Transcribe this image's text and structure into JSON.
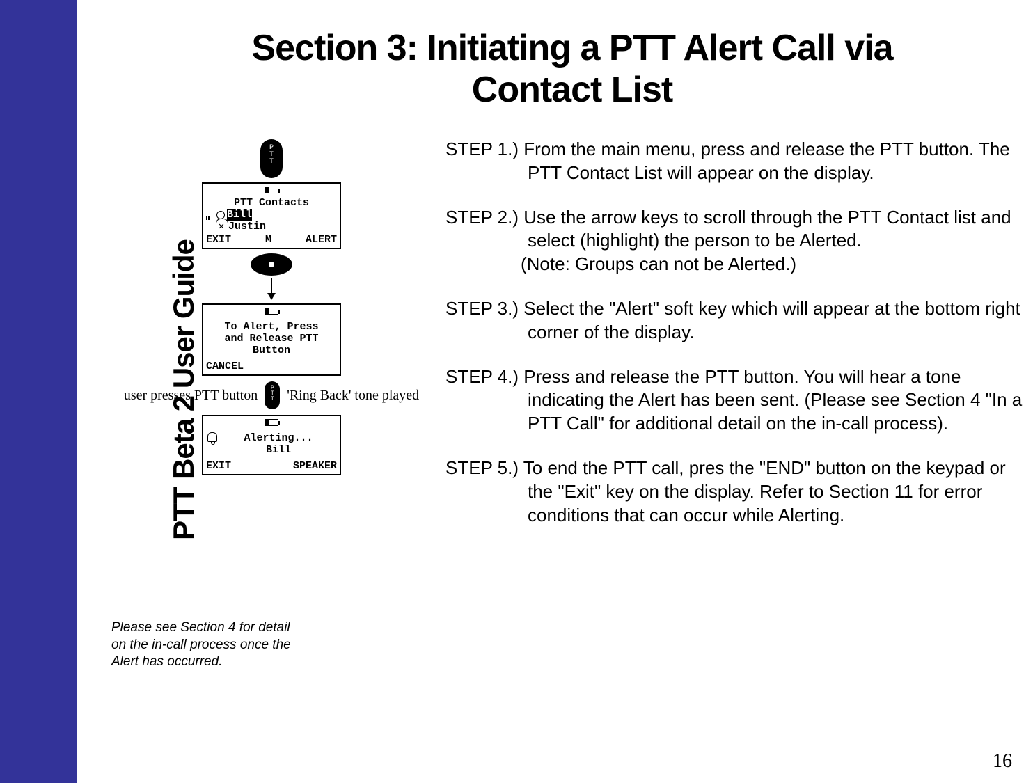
{
  "sidebar_label": "PTT Beta 2 User Guide",
  "title_line1": "Section 3: Initiating a PTT Alert Call via",
  "title_line2": "Contact List",
  "page_number": "16",
  "diagram": {
    "ptt_button_label": "P\nT\nT",
    "screen1": {
      "title": "PTT Contacts",
      "contact_selected": "Bill",
      "contact_other": "Justin",
      "soft_left": "EXIT",
      "soft_mid": "M",
      "soft_right": "ALERT"
    },
    "screen2": {
      "line1": "To Alert, Press",
      "line2": "and Release PTT",
      "line3": "Button",
      "soft_left": "CANCEL"
    },
    "mid_left": "user presses PTT button",
    "mid_right": "'Ring Back' tone played",
    "screen3": {
      "line1": "Alerting...",
      "line2": "Bill",
      "soft_left": "EXIT",
      "soft_right": "SPEAKER"
    }
  },
  "footnote": "Please see Section 4 for detail on the in-call process once the Alert has occurred.",
  "steps": {
    "s1": "STEP 1.) From the main menu, press and release the PTT button.  The PTT Contact List will appear on the display.",
    "s2a": "STEP 2.) Use the arrow keys to scroll through the PTT Contact list and select (highlight) the person to be Alerted.",
    "s2b": "(Note: Groups can not be Alerted.)",
    "s3": "STEP 3.) Select the \"Alert\" soft key which will appear at the bottom right corner of the display.",
    "s4": "STEP 4.) Press and release the PTT button.  You will hear a tone indicating the Alert has been sent.  (Please see Section 4 \"In a PTT Call\" for additional detail on the in-call process).",
    "s5": "STEP 5.) To end the PTT call, pres the \"END\" button on the keypad or the \"Exit\" key on the display. Refer to Section 11 for error conditions that can occur while Alerting."
  }
}
